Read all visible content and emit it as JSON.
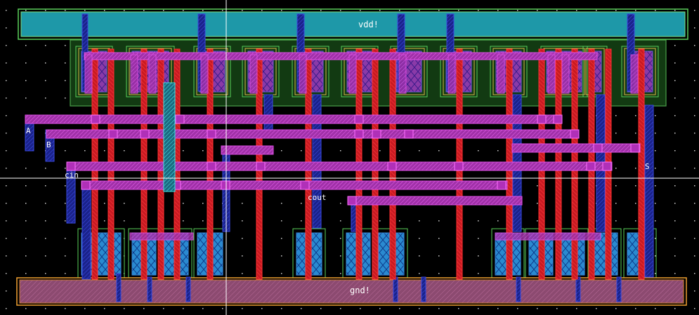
{
  "window": {
    "background": "#000000"
  },
  "rails": {
    "power": {
      "net": "vdd!",
      "fill": "#1e98a8",
      "stroke": "#7fe07f"
    },
    "ground": {
      "net": "gnd!",
      "fill": "#9a4f78",
      "stroke": "#f0a030"
    }
  },
  "nets": {
    "a": "A",
    "b": "B",
    "cin": "cin",
    "cout": "cout",
    "s": "S"
  },
  "layers": {
    "nwell": "#4a9a4a",
    "active_outline": "#d9b84a",
    "poly": "#e0202a",
    "metal1": "#c23cc8",
    "metal2": "#2030c8",
    "diffusion": "#2a9ad8",
    "via": "#40e0e0"
  }
}
